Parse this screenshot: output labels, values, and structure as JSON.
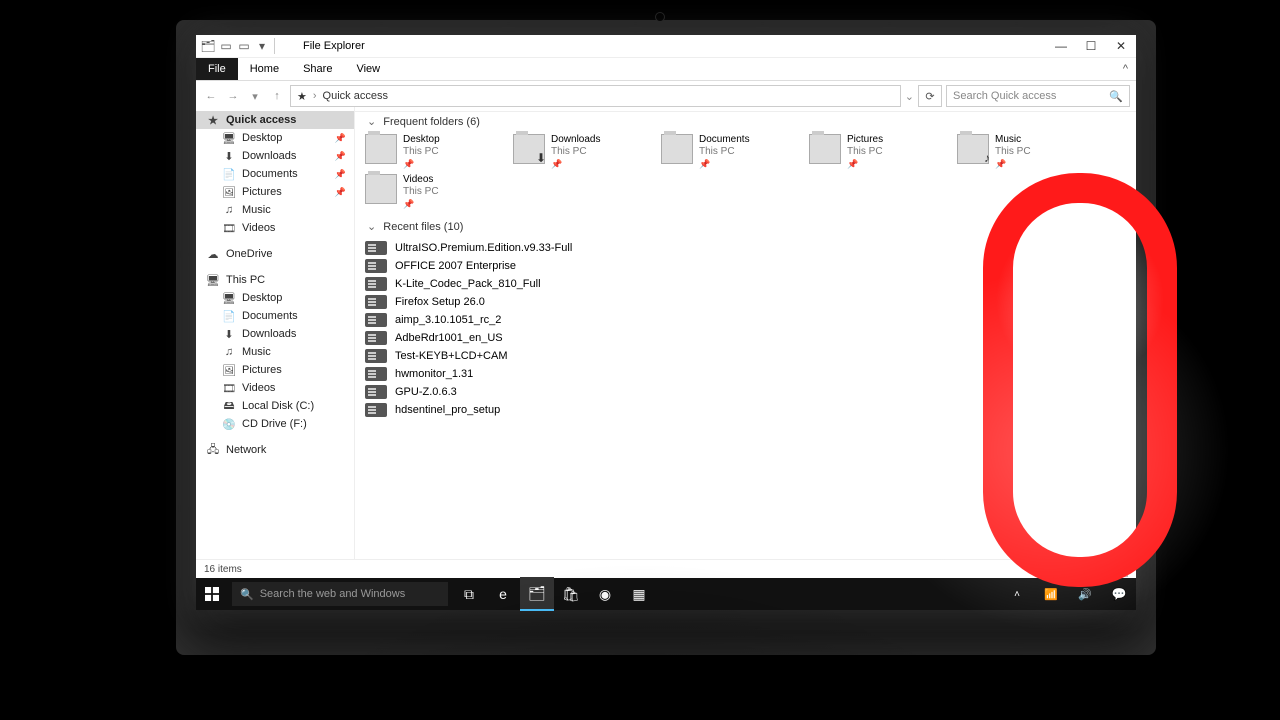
{
  "window": {
    "title": "File Explorer",
    "controls": {
      "min": "—",
      "max": "☐",
      "close": "✕"
    }
  },
  "ribbon": {
    "tabs": {
      "file": "File",
      "home": "Home",
      "share": "Share",
      "view": "View"
    }
  },
  "address": {
    "root_icon": "★",
    "location": "Quick access",
    "search_placeholder": "Search Quick access"
  },
  "sidebar": {
    "quick_access": "Quick access",
    "qa_items": [
      {
        "label": "Desktop",
        "icon": "🖥"
      },
      {
        "label": "Downloads",
        "icon": "⬇"
      },
      {
        "label": "Documents",
        "icon": "📄"
      },
      {
        "label": "Pictures",
        "icon": "🖼"
      },
      {
        "label": "Music",
        "icon": "♫"
      },
      {
        "label": "Videos",
        "icon": "🎞"
      }
    ],
    "onedrive": "OneDrive",
    "this_pc": "This PC",
    "pc_items": [
      {
        "label": "Desktop",
        "icon": "🖥"
      },
      {
        "label": "Documents",
        "icon": "📄"
      },
      {
        "label": "Downloads",
        "icon": "⬇"
      },
      {
        "label": "Music",
        "icon": "♫"
      },
      {
        "label": "Pictures",
        "icon": "🖼"
      },
      {
        "label": "Videos",
        "icon": "🎞"
      },
      {
        "label": "Local Disk (C:)",
        "icon": "🖴"
      },
      {
        "label": "CD Drive (F:)",
        "icon": "💿"
      }
    ],
    "network": "Network"
  },
  "groups": {
    "frequent": "Frequent folders (6)",
    "recent": "Recent files (10)"
  },
  "frequent_folders": [
    {
      "name": "Desktop",
      "sub": "This PC",
      "badge": ""
    },
    {
      "name": "Downloads",
      "sub": "This PC",
      "badge": "⬇"
    },
    {
      "name": "Documents",
      "sub": "This PC",
      "badge": ""
    },
    {
      "name": "Pictures",
      "sub": "This PC",
      "badge": ""
    },
    {
      "name": "Music",
      "sub": "This PC",
      "badge": "♪"
    },
    {
      "name": "Videos",
      "sub": "This PC",
      "badge": ""
    }
  ],
  "recent_files": [
    {
      "name": "UltraISO.Premium.Edition.v9.33-Full"
    },
    {
      "name": "OFFICE 2007 Enterprise"
    },
    {
      "name": "K-Lite_Codec_Pack_810_Full"
    },
    {
      "name": "Firefox Setup 26.0"
    },
    {
      "name": "aimp_3.10.1051_rc_2"
    },
    {
      "name": "AdbeRdr1001_en_US"
    },
    {
      "name": "Test-KEYB+LCD+CAM"
    },
    {
      "name": "hwmonitor_1.31"
    },
    {
      "name": "GPU-Z.0.6.3"
    },
    {
      "name": "hdsentinel_pro_setup"
    }
  ],
  "status": {
    "items": "16 items"
  },
  "taskbar": {
    "search_placeholder": "Search the web and Windows"
  }
}
